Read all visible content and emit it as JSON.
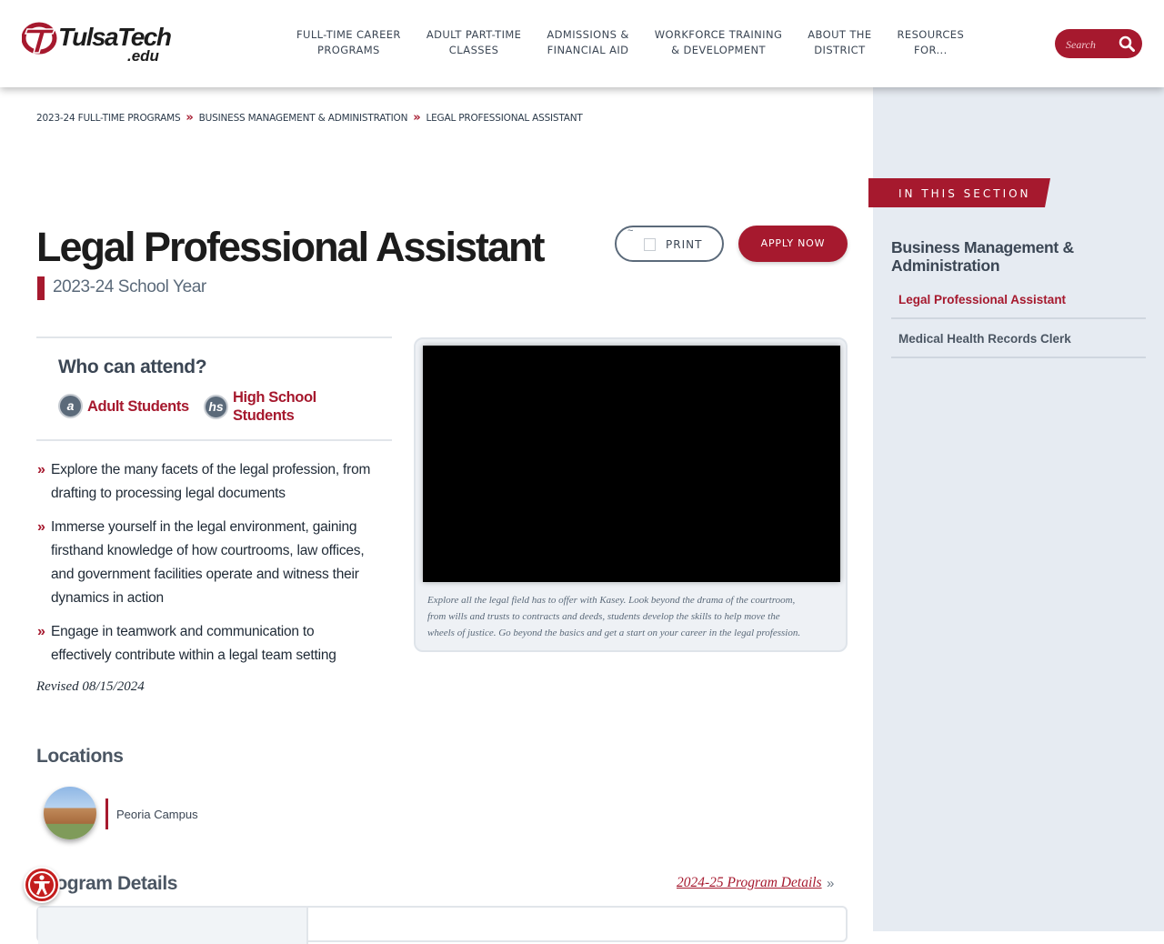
{
  "brand": {
    "name": "TulsaTech",
    "suffix": ".edu"
  },
  "nav": [
    {
      "line1": "FULL-TIME CAREER",
      "line2": "PROGRAMS"
    },
    {
      "line1": "ADULT PART-TIME",
      "line2": "CLASSES"
    },
    {
      "line1": "ADMISSIONS &",
      "line2": "FINANCIAL AID"
    },
    {
      "line1": "WORKFORCE TRAINING",
      "line2": "& DEVELOPMENT"
    },
    {
      "line1": "ABOUT THE",
      "line2": "DISTRICT"
    },
    {
      "line1": "RESOURCES",
      "line2": "FOR..."
    }
  ],
  "search": {
    "placeholder": "Search"
  },
  "breadcrumb": [
    "2023-24 FULL-TIME PROGRAMS",
    "BUSINESS MANAGEMENT & ADMINISTRATION",
    "LEGAL PROFESSIONAL ASSISTANT"
  ],
  "page": {
    "title": "Legal Professional Assistant",
    "year": "2023-24 School Year",
    "print_label": "PRINT",
    "apply_label": "APPLY NOW"
  },
  "attend": {
    "title": "Who can attend?",
    "audiences": [
      {
        "icon_text": "a",
        "icon": "adult-icon",
        "line1": "Adult Students",
        "line2": ""
      },
      {
        "icon_text": "hs",
        "icon": "high-school-icon",
        "line1": "High School",
        "line2": "Students"
      }
    ]
  },
  "bullets": [
    {
      "lines": [
        "Explore the many facets of the legal profession, from",
        "drafting to processing legal documents"
      ]
    },
    {
      "lines": [
        "Immerse yourself in the legal environment, gaining",
        "firsthand knowledge of how courtrooms, law offices,",
        "and government facilities operate and witness their",
        "dynamics in action"
      ]
    },
    {
      "lines": [
        "Engage in teamwork and communication to",
        "effectively contribute within a legal team setting"
      ]
    }
  ],
  "revised": "Revised 08/15/2024",
  "video": {
    "caption_lines": [
      "Explore all the legal field has to offer with Kasey. Look beyond the drama of the courtroom,",
      "from wills and trusts to contracts and deeds, students develop the skills to help move the",
      "wheels of justice. Go beyond the basics and get a start on your career in the legal profession."
    ]
  },
  "locations": {
    "title": "Locations",
    "items": [
      "Peoria Campus"
    ]
  },
  "program_details": {
    "title": "Program Details",
    "link": "2024-25 Program Details",
    "chevron": "»"
  },
  "sidebar": {
    "banner": "IN THIS SECTION",
    "title": "Business Management & Administration",
    "links": [
      "Legal Professional Assistant",
      "Medical Health Records Clerk"
    ]
  },
  "colors": {
    "brand_red": "#a6192e",
    "slate": "#3b4654",
    "sidebar_bg": "#e6ebf2"
  }
}
